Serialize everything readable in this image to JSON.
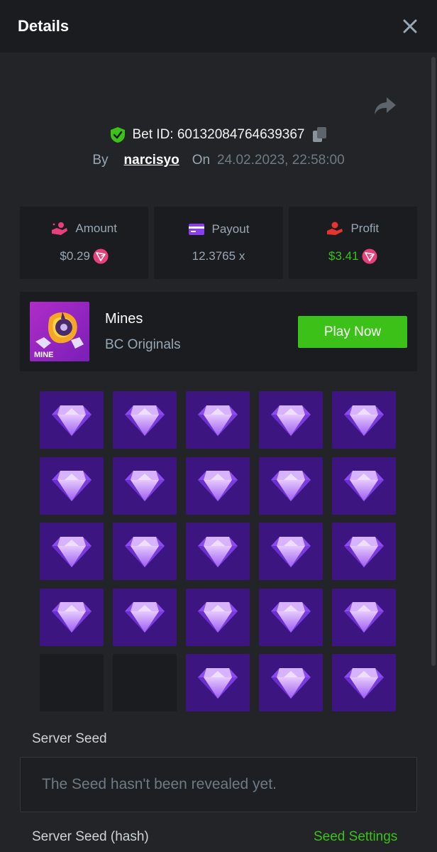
{
  "header": {
    "title": "Details"
  },
  "bet": {
    "id_text": "Bet ID: 60132084764639367",
    "by_label": "By",
    "username": "narcisyo",
    "on_label": "On",
    "datetime": "24.02.2023, 22:58:00"
  },
  "stats": [
    {
      "label": "Amount",
      "value": "$0.29",
      "icon": "coin-hand-icon"
    },
    {
      "label": "Payout",
      "value": "12.3765 x",
      "icon": "wallet-card-icon"
    },
    {
      "label": "Profit",
      "value": "$3.41",
      "icon": "profit-hand-icon"
    }
  ],
  "game": {
    "name": "Mines",
    "provider": "BC Originals",
    "thumb_text": "MINE",
    "play_label": "Play Now"
  },
  "board": {
    "tiles": [
      "gem",
      "gem",
      "gem",
      "gem",
      "gem",
      "gem",
      "gem",
      "gem",
      "gem",
      "gem",
      "gem",
      "gem",
      "gem",
      "gem",
      "gem",
      "gem",
      "gem",
      "gem",
      "gem",
      "gem",
      "empty",
      "empty",
      "gem",
      "gem",
      "gem"
    ]
  },
  "seeds": {
    "server_seed_label": "Server Seed",
    "server_seed_value": "The Seed hasn't been revealed yet.",
    "hash_label": "Server Seed (hash)",
    "settings_label": "Seed Settings"
  },
  "colors": {
    "accent_green": "#3bc117",
    "gem_tile": "#3c1580",
    "panel": "#1b1c1f",
    "background": "#232427"
  }
}
